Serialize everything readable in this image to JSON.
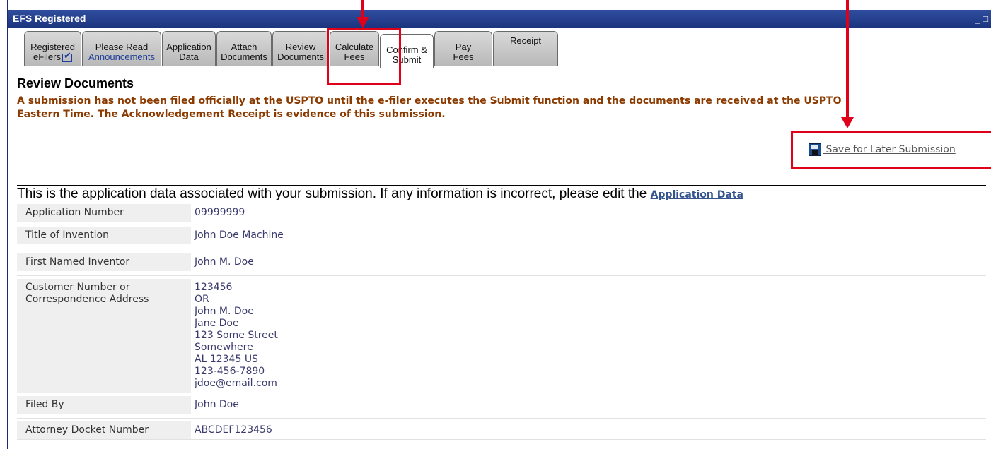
{
  "window": {
    "title": "EFS Registered",
    "controls": "_ □"
  },
  "tabs": [
    {
      "line1": "Registered",
      "line2": "eFilers",
      "has_check": true
    },
    {
      "line1": "Please Read",
      "line2": "Announcements"
    },
    {
      "line1": "Application",
      "line2": "Data"
    },
    {
      "line1": "Attach",
      "line2": "Documents"
    },
    {
      "line1": "Review",
      "line2": "Documents"
    },
    {
      "line1": "Calculate",
      "line2": "Fees"
    },
    {
      "line1": "Confirm &",
      "line2": "Submit"
    },
    {
      "line1": "Pay",
      "line2": "Fees"
    },
    {
      "line1": "Receipt",
      "line2": ""
    }
  ],
  "section_title": "Review Documents",
  "notice": "A submission has not been filed officially at the USPTO until the e-filer executes the Submit function and the documents are received at the USPTO\nEastern Time. The Acknowledgement Receipt is evidence of this submission.",
  "save_link": {
    "label": " Save for Later Submission",
    "icon": "floppy-disk-icon"
  },
  "application_heading": {
    "text": "This is the application data associated with your submission. If any information is incorrect, please edit the ",
    "link": "Application Data"
  },
  "app_data": {
    "application_number": {
      "label": "Application Number",
      "value": "09999999"
    },
    "title_of_invention": {
      "label": "Title of Invention",
      "value": "John Doe Machine"
    },
    "first_named_inventor": {
      "label": "First Named Inventor",
      "value": "John M. Doe"
    },
    "customer_number": {
      "label_line1": "Customer Number or",
      "label_line2": "Correspondence Address",
      "lines": [
        "123456",
        "OR",
        "John M. Doe",
        "Jane Doe",
        "123 Some Street",
        "Somewhere",
        "AL 12345 US",
        "123-456-7890",
        "jdoe@email.com"
      ]
    },
    "filed_by": {
      "label": "Filed By",
      "value": "John Doe"
    },
    "attorney_docket_number": {
      "label": "Attorney Docket Number",
      "value": "ABCDEF123456"
    }
  },
  "colors": {
    "title_bar": "#1c3580",
    "notice_text": "#8b3a00",
    "annotation_red": "#e0001a",
    "link": "#34538f"
  }
}
